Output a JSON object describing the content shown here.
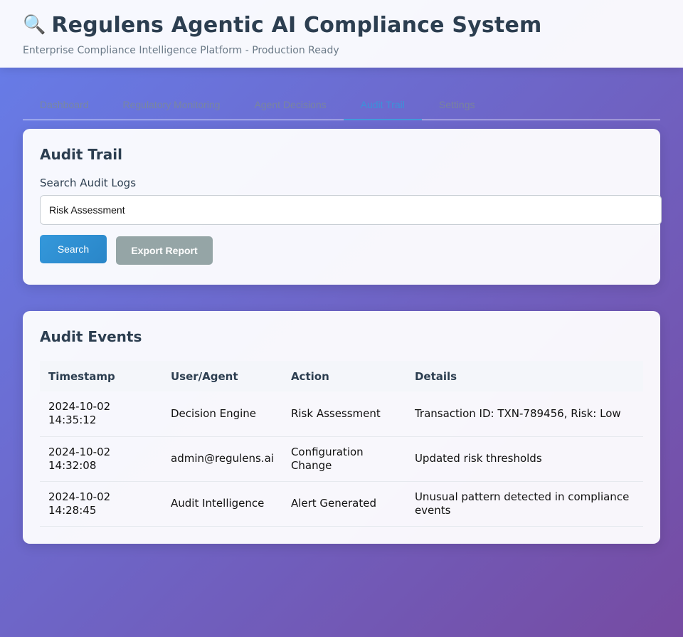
{
  "header": {
    "icon": "magnifier-icon",
    "title": "Regulens Agentic AI Compliance System",
    "subtitle": "Enterprise Compliance Intelligence Platform - Production Ready"
  },
  "tabs": [
    {
      "label": "Dashboard",
      "active": false
    },
    {
      "label": "Regulatory Monitoring",
      "active": false
    },
    {
      "label": "Agent Decisions",
      "active": false
    },
    {
      "label": "Audit Trail",
      "active": true
    },
    {
      "label": "Settings",
      "active": false
    }
  ],
  "audit_trail": {
    "title": "Audit Trail",
    "search_label": "Search Audit Logs",
    "search_value": "Risk Assessment",
    "search_button": "Search",
    "export_button": "Export Report"
  },
  "audit_events": {
    "title": "Audit Events",
    "columns": [
      "Timestamp",
      "User/Agent",
      "Action",
      "Details"
    ],
    "rows": [
      {
        "timestamp": "2024-10-02 14:35:12",
        "user": "Decision Engine",
        "action": "Risk Assessment",
        "details": "Transaction ID: TXN-789456, Risk: Low"
      },
      {
        "timestamp": "2024-10-02 14:32:08",
        "user": "admin@regulens.ai",
        "action": "Configuration Change",
        "details": "Updated risk thresholds"
      },
      {
        "timestamp": "2024-10-02 14:28:45",
        "user": "Audit Intelligence",
        "action": "Alert Generated",
        "details": "Unusual pattern detected in compliance events"
      }
    ]
  },
  "colors": {
    "accent": "#3498db",
    "heading": "#2c3e50",
    "secondary_button": "#95a5a6",
    "bg_start": "#667eea",
    "bg_end": "#764ba2"
  }
}
